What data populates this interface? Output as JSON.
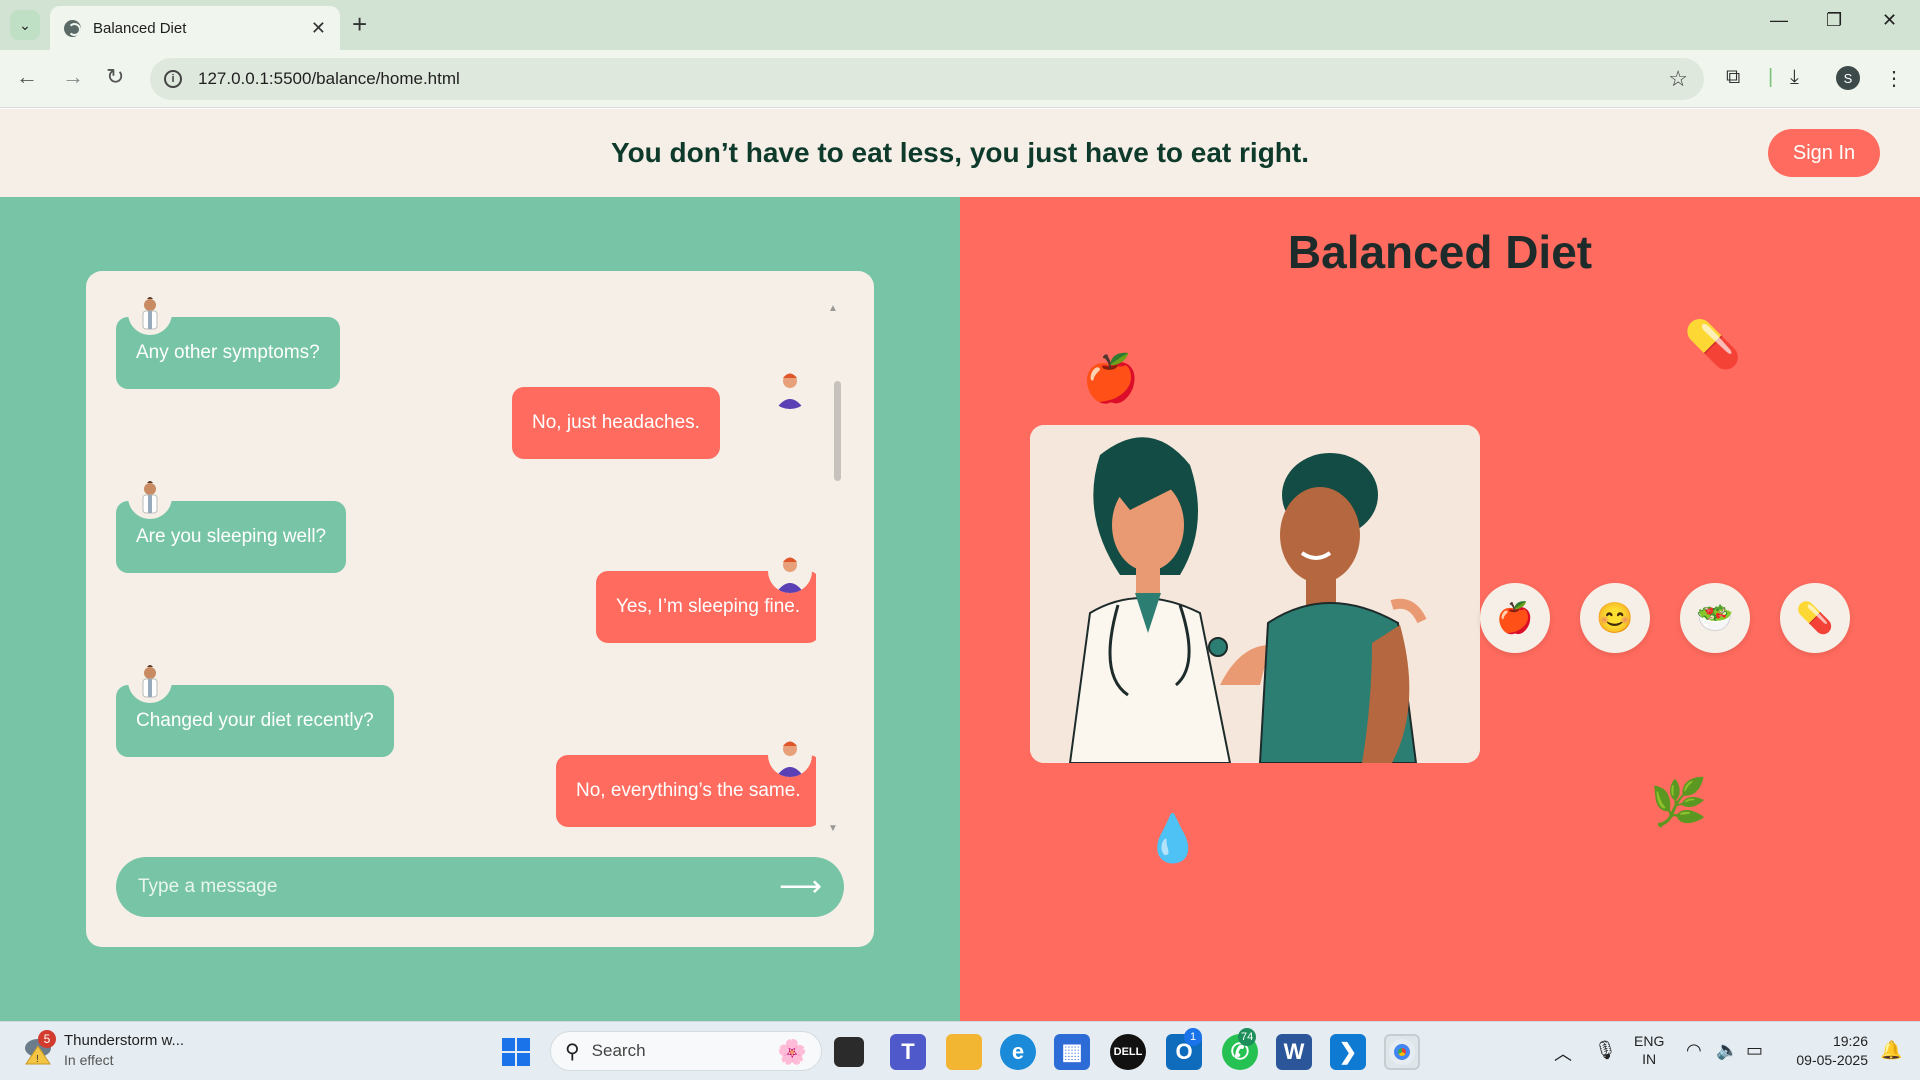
{
  "browser": {
    "tab_title": "Balanced Diet",
    "url": "127.0.0.1:5500/balance/home.html",
    "profile_initial": "S"
  },
  "banner": {
    "quote": "You don’t have to eat less, you just have to eat right.",
    "signin_label": "Sign In"
  },
  "chat": {
    "messages": [
      {
        "from": "doctor",
        "text": "Any other symptoms?"
      },
      {
        "from": "patient",
        "text": "No, just headaches."
      },
      {
        "from": "doctor",
        "text": "Are you sleeping well?"
      },
      {
        "from": "patient",
        "text": "Yes, I’m sleeping fine."
      },
      {
        "from": "doctor",
        "text": "Changed your diet recently?"
      },
      {
        "from": "patient",
        "text": "No, everything’s the same."
      }
    ],
    "input_placeholder": "Type a message",
    "send_icon": "arrow-right-icon"
  },
  "right_panel": {
    "title": "Balanced Diet",
    "floating_icons": [
      "apple-icon",
      "pill-icon",
      "water-drop-icon",
      "herb-icon"
    ],
    "circle_icons": [
      "apple-icon",
      "smile-icon",
      "salad-icon",
      "pill-icon"
    ]
  },
  "colors": {
    "mint": "#77c5a6",
    "coral": "#ff6b5e",
    "cream": "#f6efe7",
    "heading": "#0e3a2c"
  },
  "taskbar": {
    "weather_title": "Thunderstorm w...",
    "weather_status": "In effect",
    "weather_badge": "5",
    "search_label": "Search",
    "outlook_badge": "1",
    "whatsapp_badge": "74",
    "lang_line1": "ENG",
    "lang_line2": "IN",
    "time": "19:26",
    "date": "09-05-2025"
  }
}
